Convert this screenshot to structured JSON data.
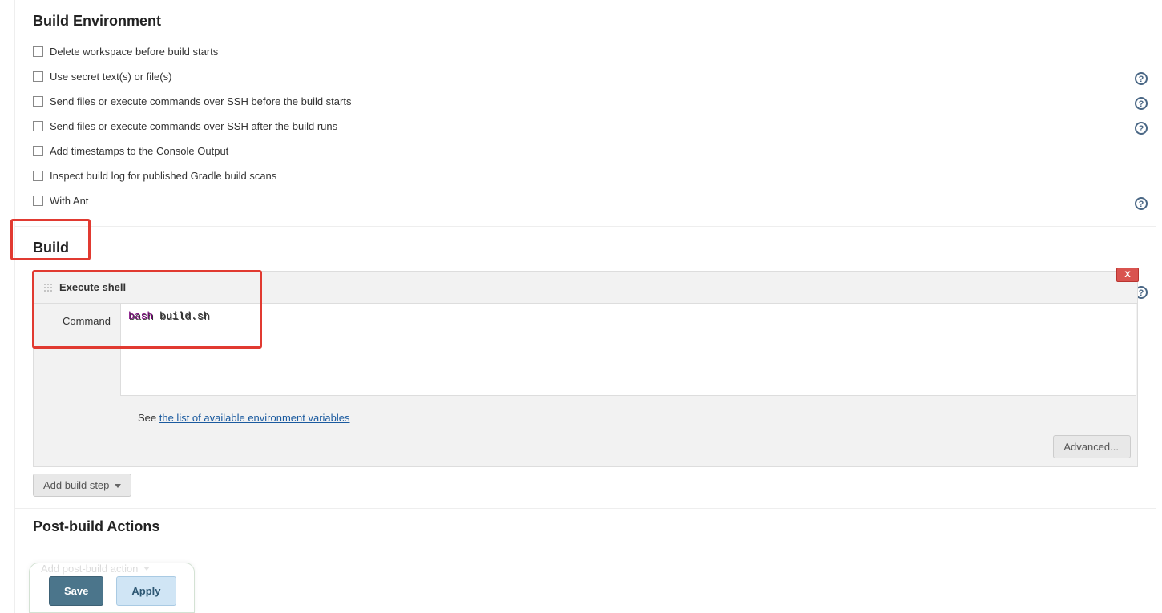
{
  "sections": {
    "build_environment": {
      "title": "Build Environment"
    },
    "build": {
      "title": "Build"
    },
    "post_build": {
      "title": "Post-build Actions"
    }
  },
  "env_options": [
    {
      "label": "Delete workspace before build starts",
      "checked": false,
      "help": false
    },
    {
      "label": "Use secret text(s) or file(s)",
      "checked": false,
      "help": true
    },
    {
      "label": "Send files or execute commands over SSH before the build starts",
      "checked": false,
      "help": true
    },
    {
      "label": "Send files or execute commands over SSH after the build runs",
      "checked": false,
      "help": true
    },
    {
      "label": "Add timestamps to the Console Output",
      "checked": false,
      "help": false
    },
    {
      "label": "Inspect build log for published Gradle build scans",
      "checked": false,
      "help": false
    },
    {
      "label": "With Ant",
      "checked": false,
      "help": true
    }
  ],
  "build_step": {
    "title": "Execute shell",
    "command_label": "Command",
    "command_value": "bash build.sh",
    "help_prefix": "See ",
    "help_link_text": "the list of available environment variables",
    "delete_label": "X"
  },
  "buttons": {
    "advanced": "Advanced...",
    "add_build_step": "Add build step",
    "add_post_build_action": "Add post-build action",
    "save": "Save",
    "apply": "Apply"
  }
}
